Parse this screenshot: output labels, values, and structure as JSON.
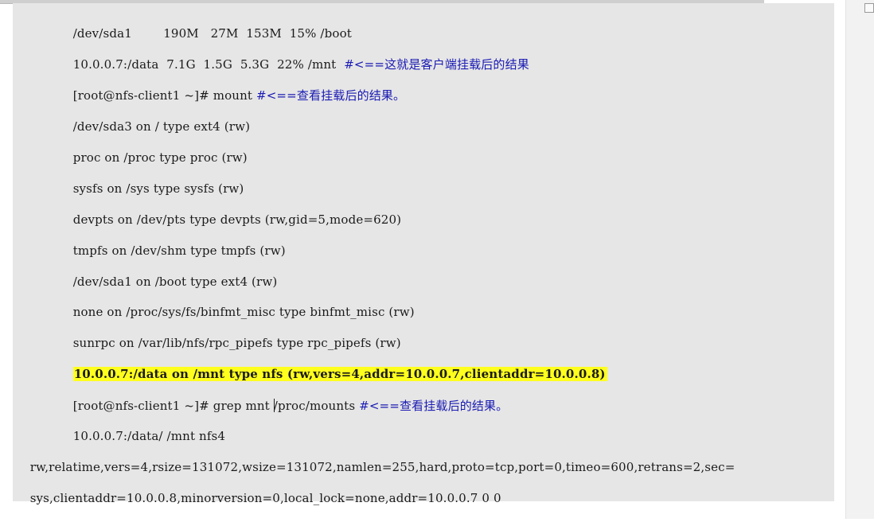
{
  "document": {
    "lines": [
      {
        "text": "/dev/sda1        190M   27M  153M  15% /boot",
        "comment": ""
      },
      {
        "text": "10.0.0.7:/data  7.1G  1.5G  5.3G  22% /mnt  ",
        "comment": "#<==这就是客户端挂载后的结果"
      },
      {
        "text": "[root@nfs-client1 ~]# mount ",
        "comment": "#<==查看挂载后的结果。"
      },
      {
        "text": "/dev/sda3 on / type ext4 (rw)",
        "comment": ""
      },
      {
        "text": "proc on /proc type proc (rw)",
        "comment": ""
      },
      {
        "text": "sysfs on /sys type sysfs (rw)",
        "comment": ""
      },
      {
        "text": "devpts on /dev/pts type devpts (rw,gid=5,mode=620)",
        "comment": ""
      },
      {
        "text": "tmpfs on /dev/shm type tmpfs (rw)",
        "comment": ""
      },
      {
        "text": "/dev/sda1 on /boot type ext4 (rw)",
        "comment": ""
      },
      {
        "text": "none on /proc/sys/fs/binfmt_misc type binfmt_misc (rw)",
        "comment": ""
      },
      {
        "text": "sunrpc on /var/lib/nfs/rpc_pipefs type rpc_pipefs (rw)",
        "comment": ""
      },
      {
        "text": "10.0.0.7:/data on /mnt type nfs (rw,vers=4,addr=10.0.0.7,clientaddr=10.0.0.8)",
        "comment": ""
      },
      {
        "text_before_cursor": "[root@nfs-client1 ~]# grep mnt ",
        "text_after_cursor": "/proc/mounts ",
        "comment": "#<==查看挂载后的结果。"
      },
      {
        "text": "10.0.0.7:/data/ /mnt nfs4",
        "comment": ""
      },
      {
        "text": "rw,relatime,vers=4,rsize=131072,wsize=131072,namlen=255,hard,proto=tcp,port=0,timeo=600,retrans=2,sec=",
        "comment": ""
      },
      {
        "text": "sys,clientaddr=10.0.0.8,minorversion=0,local_lock=none,addr=10.0.0.7 0 0",
        "comment": ""
      }
    ]
  },
  "colors": {
    "comment": "#1a1ab4",
    "highlight": "#ffff1e",
    "page": "#e6e6e6"
  }
}
